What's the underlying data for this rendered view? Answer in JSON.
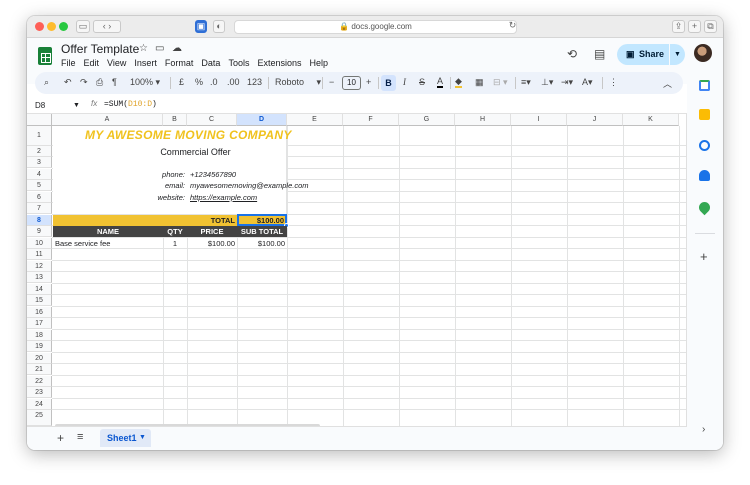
{
  "browser": {
    "url": "docs.google.com"
  },
  "doc": {
    "title": "Offer Template"
  },
  "menu": [
    "File",
    "Edit",
    "View",
    "Insert",
    "Format",
    "Data",
    "Tools",
    "Extensions",
    "Help"
  ],
  "share": {
    "label": "Share"
  },
  "toolbar": {
    "zoom": "100%",
    "currency": "£",
    "percent": "%",
    "dec_decrease": ".0",
    "dec_increase": ".00",
    "format_123": "123",
    "font": "Roboto",
    "font_size": "10",
    "bold": "B",
    "italic": "I",
    "underline_text": "A"
  },
  "formula_bar": {
    "cell_ref": "D8",
    "fx": "fx",
    "formula_prefix": "=SUM(",
    "formula_range": "D10:D",
    "formula_suffix": ")"
  },
  "columns": [
    "A",
    "B",
    "C",
    "D",
    "E",
    "F",
    "G",
    "H",
    "I",
    "J",
    "K"
  ],
  "rows": [
    "1",
    "2",
    "3",
    "4",
    "5",
    "6",
    "7",
    "8",
    "9",
    "10",
    "11",
    "12",
    "13",
    "14",
    "15",
    "16",
    "17",
    "18",
    "19",
    "20",
    "21",
    "22",
    "23",
    "24",
    "25"
  ],
  "sheet": {
    "company": "MY AWESOME MOVING COMPANY",
    "subtitle": "Commercial Offer",
    "phone_label": "phone:",
    "phone": "+1234567890",
    "email_label": "email:",
    "email": "myawesomemoving@example.com",
    "website_label": "website:",
    "website": "https://example.com",
    "total_label": "TOTAL",
    "total_value": "$100.00",
    "header_name": "NAME",
    "header_qty": "QTY",
    "header_price": "PRICE",
    "header_subtotal": "SUB TOTAL",
    "item_name": "Base service fee",
    "item_qty": "1",
    "item_price": "$100.00",
    "item_subtotal": "$100.00"
  },
  "tabs": [
    {
      "label": "Sheet1"
    }
  ],
  "colors": {
    "accent_yellow": "#f1c232",
    "header_dark": "#434343",
    "share_bg": "#c2e7ff",
    "sheets_green": "#188038"
  }
}
